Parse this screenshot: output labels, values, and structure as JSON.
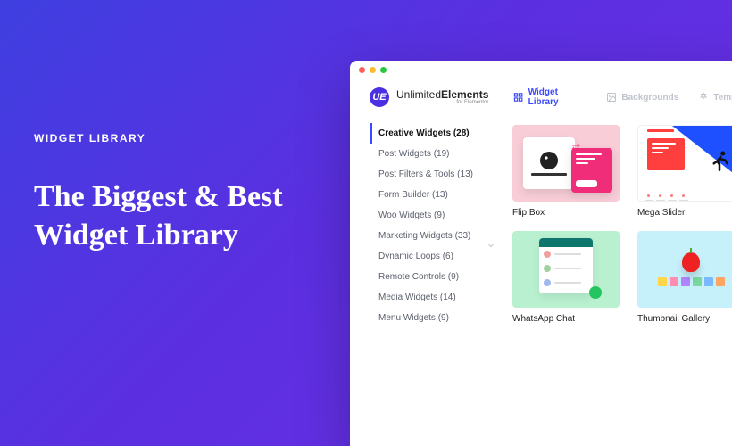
{
  "hero": {
    "eyebrow": "WIDGET LIBRARY",
    "headline": "The Biggest & Best Widget Library"
  },
  "brand": {
    "badge": "UE",
    "name_a": "Unlimited",
    "name_b": "Elements",
    "sub": "for Elementor"
  },
  "tabs": [
    {
      "label": "Widget Library",
      "active": true
    },
    {
      "label": "Backgrounds",
      "active": false
    },
    {
      "label": "Templates",
      "active": false
    }
  ],
  "sidebar": [
    {
      "label": "Creative Widgets (28)",
      "active": true
    },
    {
      "label": "Post Widgets (19)"
    },
    {
      "label": "Post Filters & Tools (13)"
    },
    {
      "label": "Form Builder (13)"
    },
    {
      "label": "Woo Widgets (9)"
    },
    {
      "label": "Marketing Widgets (33)"
    },
    {
      "label": "Dynamic Loops (6)"
    },
    {
      "label": "Remote Controls (9)"
    },
    {
      "label": "Media Widgets (14)"
    },
    {
      "label": "Menu Widgets (9)"
    }
  ],
  "cards": [
    {
      "label": "Flip Box"
    },
    {
      "label": "Mega Slider"
    },
    {
      "label": "WhatsApp Chat"
    },
    {
      "label": "Thumbnail Gallery"
    }
  ]
}
